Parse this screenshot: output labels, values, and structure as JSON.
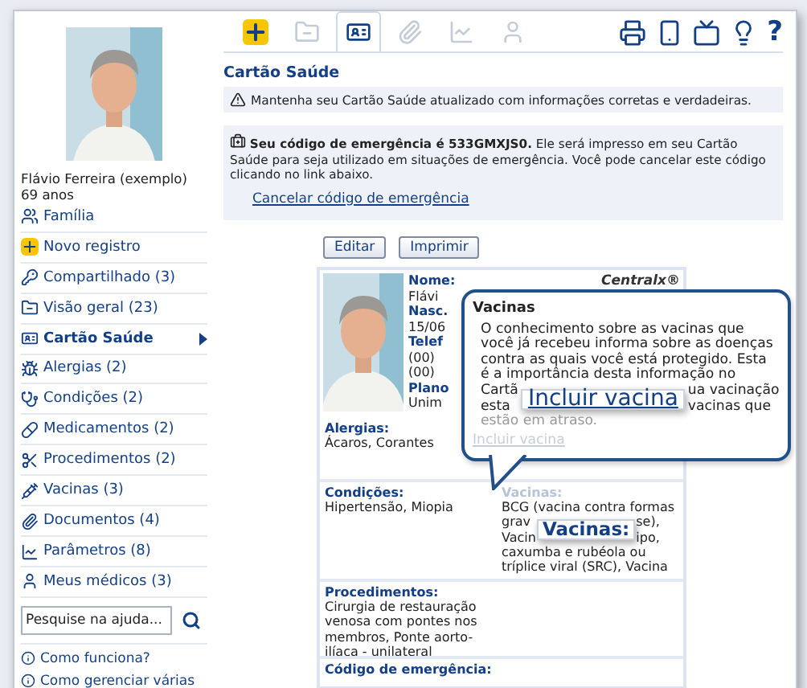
{
  "patient": {
    "name": "Flávio Ferreira (exemplo)",
    "age": "69 anos"
  },
  "family_link": "Família",
  "nav": [
    {
      "label": "Novo registro",
      "selected": false
    },
    {
      "label": "Compartilhado (3)",
      "selected": false
    },
    {
      "label": "Visão geral (23)",
      "selected": false
    },
    {
      "label": "Cartão Saúde",
      "selected": true
    },
    {
      "label": "Alergias (2)",
      "selected": false
    },
    {
      "label": "Condições (2)",
      "selected": false
    },
    {
      "label": "Medicamentos (2)",
      "selected": false
    },
    {
      "label": "Procedimentos (2)",
      "selected": false
    },
    {
      "label": "Vacinas (3)",
      "selected": false
    },
    {
      "label": "Documentos (4)",
      "selected": false
    },
    {
      "label": "Parâmetros (8)",
      "selected": false
    },
    {
      "label": "Meus médicos (3)",
      "selected": false
    }
  ],
  "search": {
    "placeholder": "Pesquise na ajuda..."
  },
  "help_links": [
    "Como funciona?",
    "Como gerenciar várias"
  ],
  "toolbar": {
    "tabs": [
      {
        "selected": false,
        "disabled": false
      },
      {
        "selected": false,
        "disabled": true
      },
      {
        "selected": true,
        "disabled": false
      },
      {
        "selected": false,
        "disabled": true
      },
      {
        "selected": false,
        "disabled": true
      },
      {
        "selected": false,
        "disabled": true
      }
    ],
    "help": "?"
  },
  "page_title": "Cartão Saúde",
  "notice": "Mantenha seu Cartão Saúde atualizado com informações corretas e verdadeiras.",
  "emergency": {
    "text": "**Seu código de emergência é 533GMXJS0.** Ele será impresso em seu Cartão Saúde para seja utilizado em situações de emergência. Você pode cancelar este código clicando no link abaixo.",
    "link": "Cancelar código de emergência"
  },
  "buttons": [
    "Editar",
    "Imprimir"
  ],
  "card": {
    "brand": "Centralx®",
    "fields": [
      {
        "label": "Nome:",
        "lines": [
          "Flávi"
        ]
      },
      {
        "label": "Nasc.",
        "lines": [
          "15/06"
        ]
      },
      {
        "label": "Telef",
        "lines": [
          "(00)",
          "(00)"
        ]
      },
      {
        "label": "Plano",
        "lines": [
          "Unim"
        ]
      }
    ],
    "allergies": {
      "label": "Alergias:",
      "value": "Ácaros, Corantes"
    },
    "conditions": {
      "label": "Condições:",
      "value": "Hipertensão, Miopia"
    },
    "vaccines": {
      "label": "Vacinas:",
      "line_1": "BCG (vacina contra formas",
      "left": [
        "grav",
        "Vacin"
      ],
      "right": [
        "se),",
        "ipo,"
      ],
      "rest": [
        "caxumba e rubéola ou",
        "tríplice viral (SRC), Vacina"
      ],
      "callout": "Vacinas:"
    },
    "procedures": {
      "label": "Procedimentos:",
      "value": "Cirurgia de restauração venosa com pontes nos membros, Ponte aorto-ilíaca - unilateral"
    },
    "emergency_label": "Código de emergência:"
  },
  "tooltip": {
    "title": "Vacinas",
    "lines": [
      "O conhecimento sobre as vacinas que",
      "você já recebeu informa sobre as doenças",
      "contra as quais você está protegido. Esta",
      "é a importância desta informação no"
    ],
    "left": [
      "Cartã",
      "esta"
    ],
    "right": [
      "ua vacinação",
      "vacinas que"
    ],
    "last": "estão em atraso.",
    "faded_link": "Incluir vacina",
    "callout": "Incluir vacina"
  }
}
